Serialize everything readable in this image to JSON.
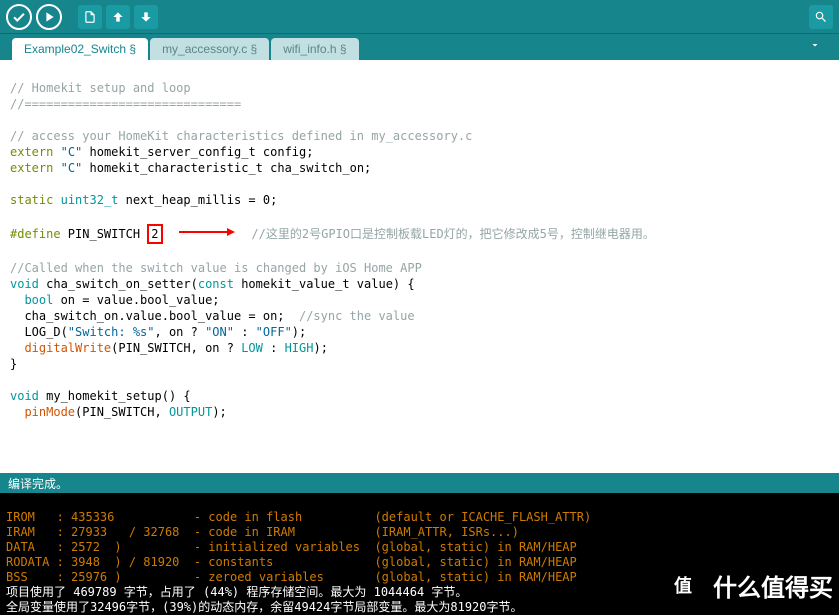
{
  "tabs": {
    "t0": "Example02_Switch §",
    "t1": "my_accessory.c §",
    "t2": "wifi_info.h §"
  },
  "code": {
    "l1": "// Homekit setup and loop",
    "l2": "//==============================",
    "l3": "// access your HomeKit characteristics defined in my_accessory.c",
    "l4a": "extern",
    "l4b": "\"C\"",
    "l4c": " homekit_server_config_t config;",
    "l5a": "extern",
    "l5b": "\"C\"",
    "l5c": " homekit_characteristic_t cha_switch_on;",
    "l6a": "static",
    "l6b": "uint32_t",
    "l6c": " next_heap_millis = 0;",
    "l7a": "#define",
    "l7b": " PIN_SWITCH ",
    "l7box": "2",
    "l7note": "//这里的2号GPIO口是控制板载LED灯的，把它修改成5号，控制继电器用。",
    "l8": "//Called when the switch value is changed by iOS Home APP",
    "l9a": "void",
    "l9b": " cha_switch_on_setter(",
    "l9c": "const",
    "l9d": " homekit_value_t value) {",
    "l10a": "bool",
    "l10b": " on = value.bool_value;",
    "l11a": "  cha_switch_on.value.bool_value = on;  ",
    "l11b": "//sync the value",
    "l12a": "  LOG_D(",
    "l12b": "\"Switch: %s\"",
    "l12c": ", on ? ",
    "l12d": "\"ON\"",
    "l12e": " : ",
    "l12f": "\"OFF\"",
    "l12g": ");",
    "l13a": "digitalWrite",
    "l13b": "(PIN_SWITCH, on ? ",
    "l13c": "LOW",
    "l13d": " : ",
    "l13e": "HIGH",
    "l13f": ");",
    "l14": "}",
    "l15a": "void",
    "l15b": " my_homekit_setup() {",
    "l16a": "pinMode",
    "l16b": "(PIN_SWITCH, ",
    "l16c": "OUTPUT",
    "l16d": ");"
  },
  "status": "编译完成。",
  "console": {
    "r1": "IROM   : 435336           - code in flash          (default or ICACHE_FLASH_ATTR)",
    "r2": "IRAM   : 27933   / 32768  - code in IRAM           (IRAM_ATTR, ISRs...)",
    "r3": "DATA   : 2572  )          - initialized variables  (global, static) in RAM/HEAP",
    "r4": "RODATA : 3948  ) / 81920  - constants              (global, static) in RAM/HEAP",
    "r5": "BSS    : 25976 )          - zeroed variables       (global, static) in RAM/HEAP",
    "r6": "项目使用了 469789 字节，占用了 (44%) 程序存储空间。最大为 1044464 字节。",
    "r7": "全局变量使用了32496字节，(39%)的动态内存，余留49424字节局部变量。最大为81920字节。"
  },
  "watermark": {
    "circle": "值",
    "text": "什么值得买"
  }
}
